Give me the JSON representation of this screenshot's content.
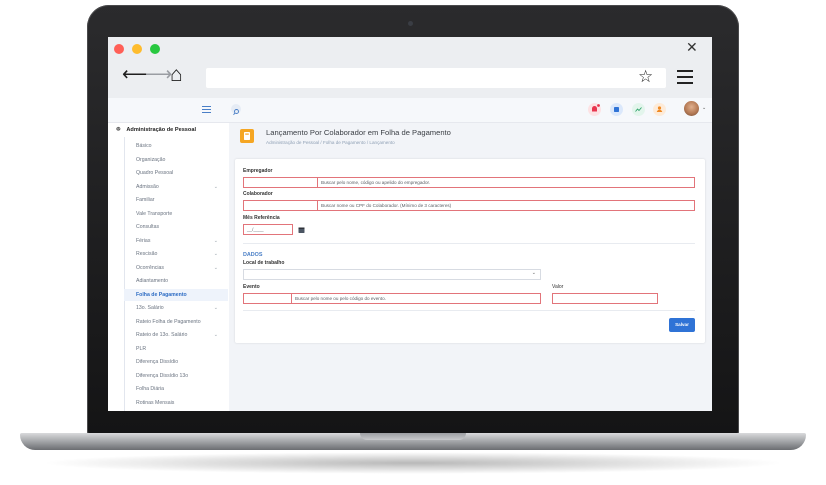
{
  "window": {
    "close_glyph": "✕",
    "back_glyph": "⟵",
    "forward_glyph": "⟶",
    "home_glyph": "⌂",
    "star_glyph": "☆"
  },
  "colors": {
    "accent": "#2f73d6",
    "error_border": "#e2747a",
    "traffic_red": "#ff5f57",
    "traffic_yellow": "#febc2e",
    "traffic_green": "#28c840"
  },
  "sidebar": {
    "module_title": "Administração de Pessoal",
    "items": [
      {
        "label": "Básico",
        "chevron": false
      },
      {
        "label": "Organização",
        "chevron": false
      },
      {
        "label": "Quadro Pessoal",
        "chevron": false
      },
      {
        "label": "Admissão",
        "chevron": true
      },
      {
        "label": "Familiar",
        "chevron": false
      },
      {
        "label": "Vale Transporte",
        "chevron": false
      },
      {
        "label": "Consultas",
        "chevron": false
      },
      {
        "label": "Férias",
        "chevron": true
      },
      {
        "label": "Rescisão",
        "chevron": true
      },
      {
        "label": "Ocorrências",
        "chevron": true
      },
      {
        "label": "Adiantamento",
        "chevron": false
      },
      {
        "label": "Folha de Pagamento",
        "chevron": false,
        "active": true
      },
      {
        "label": "13o. Salário",
        "chevron": true
      },
      {
        "label": "Rateio Folha de Pagamento",
        "chevron": false
      },
      {
        "label": "Rateio de 13o. Salário",
        "chevron": true
      },
      {
        "label": "PLR",
        "chevron": false
      },
      {
        "label": "Diferença Dissídio",
        "chevron": false
      },
      {
        "label": "Diferença Dissídio 13o",
        "chevron": false
      },
      {
        "label": "Folha Diária",
        "chevron": false
      },
      {
        "label": "Rotinas Mensais",
        "chevron": false
      }
    ]
  },
  "page": {
    "title": "Lançamento Por Colaborador em Folha de Pagamento",
    "breadcrumb": "Administração de Pessoal  /  Folha de Pagamento  /  Lançamento"
  },
  "form": {
    "empregador": {
      "label": "Empregador",
      "placeholder": "Buscar pelo nome, código ou apelido do empregador."
    },
    "colaborador": {
      "label": "Colaborador",
      "placeholder": "Buscar nome ou CPF do Colaborador. (Mínimo de 3 caracteres)"
    },
    "mes_referencia": {
      "label": "Mês Referência",
      "value": "__/____"
    },
    "section_title": "DADOS",
    "local_trabalho": {
      "label": "Local de trabalho",
      "value": ""
    },
    "evento": {
      "label": "Evento",
      "placeholder": "Buscar pelo nome ou pelo código do evento."
    },
    "valor": {
      "label": "Valor",
      "value": ""
    },
    "save_label": "Salvar"
  }
}
